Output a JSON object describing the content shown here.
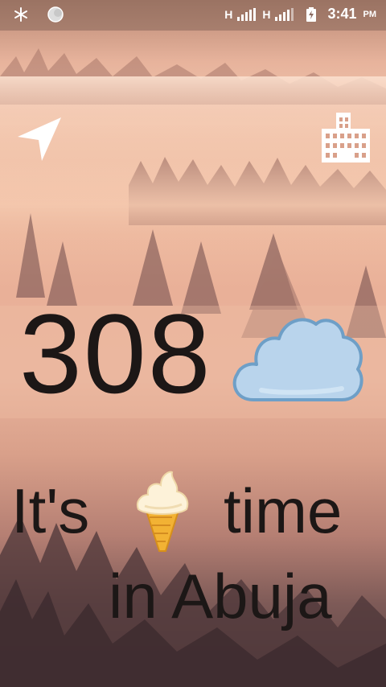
{
  "status_bar": {
    "left_icons": [
      "snowflake-icon",
      "circle-icon"
    ],
    "network_1": "H",
    "network_2": "H",
    "time": "3:41",
    "ampm": "PM"
  },
  "toolbar": {
    "location_icon": "navigation-arrow-icon",
    "city_icon": "buildings-icon"
  },
  "weather": {
    "temperature": "308",
    "condition_icon": "cloud-icon"
  },
  "phrase": {
    "word_1": "It's",
    "icon": "ice-cream-icon",
    "word_2": "time",
    "line_2": "in Abuja"
  },
  "colors": {
    "text": "#1c1716",
    "icon_white": "#ffffff",
    "cloud_fill": "#b7d3ea",
    "cloud_outline": "#6e9fc7"
  }
}
